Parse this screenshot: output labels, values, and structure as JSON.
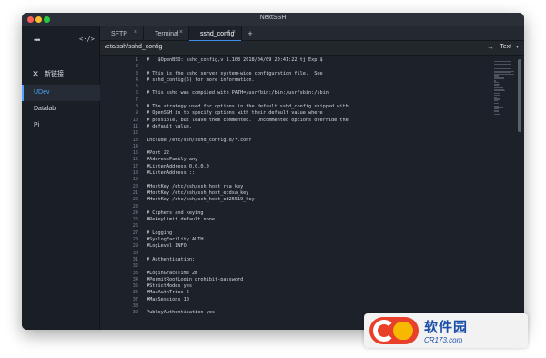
{
  "window": {
    "title": "NextSSH"
  },
  "sidebar": {
    "more_label": "•••",
    "code_label": "<·/>",
    "new_connection_label": "新链接",
    "items": [
      {
        "label": "UDev",
        "active": true
      },
      {
        "label": "Datalab",
        "active": false
      },
      {
        "label": "Pi",
        "active": false
      }
    ]
  },
  "tabs": [
    {
      "label": "SFTP",
      "active": false
    },
    {
      "label": "Terminal",
      "active": false
    },
    {
      "label": "sshd_config",
      "active": true
    }
  ],
  "tab_close_glyph": "×",
  "tab_add_glyph": "+",
  "pathbar": {
    "path": "/etc/ssh/sshd_config",
    "go_glyph": "→",
    "mode": "Text"
  },
  "editor": {
    "lines": [
      {
        "n": "1",
        "text": "#   $OpenBSD: sshd_config,v 1.103 2018/04/09 20:41:22 tj Exp $"
      },
      {
        "n": "2",
        "text": ""
      },
      {
        "n": "3",
        "text": "# This is the sshd server system-wide configuration file.  See"
      },
      {
        "n": "4",
        "text": "# sshd_config(5) for more information."
      },
      {
        "n": "5",
        "text": ""
      },
      {
        "n": "6",
        "text": "# This sshd was compiled with PATH=/usr/bin:/bin:/usr/sbin:/sbin"
      },
      {
        "n": "7",
        "text": ""
      },
      {
        "n": "8",
        "text": "# The strategy used for options in the default sshd_config shipped with"
      },
      {
        "n": "9",
        "text": "# OpenSSH is to specify options with their default value where"
      },
      {
        "n": "10",
        "text": "# possible, but leave them commented.  Uncommented options override the"
      },
      {
        "n": "11",
        "text": "# default value."
      },
      {
        "n": "12",
        "text": ""
      },
      {
        "n": "13",
        "text": "Include /etc/ssh/sshd_config.d/*.conf"
      },
      {
        "n": "14",
        "text": ""
      },
      {
        "n": "15",
        "text": "#Port 22"
      },
      {
        "n": "16",
        "text": "#AddressFamily any"
      },
      {
        "n": "17",
        "text": "#ListenAddress 0.0.0.0"
      },
      {
        "n": "18",
        "text": "#ListenAddress ::"
      },
      {
        "n": "19",
        "text": ""
      },
      {
        "n": "20",
        "text": "#HostKey /etc/ssh/ssh_host_rsa_key"
      },
      {
        "n": "21",
        "text": "#HostKey /etc/ssh/ssh_host_ecdsa_key"
      },
      {
        "n": "22",
        "text": "#HostKey /etc/ssh/ssh_host_ed25519_key"
      },
      {
        "n": "23",
        "text": ""
      },
      {
        "n": "24",
        "text": "# Ciphers and keying"
      },
      {
        "n": "25",
        "text": "#RekeyLimit default none"
      },
      {
        "n": "26",
        "text": ""
      },
      {
        "n": "27",
        "text": "# Logging"
      },
      {
        "n": "28",
        "text": "#SyslogFacility AUTH"
      },
      {
        "n": "29",
        "text": "#LogLevel INFO"
      },
      {
        "n": "30",
        "text": ""
      },
      {
        "n": "31",
        "text": "# Authentication:"
      },
      {
        "n": "32",
        "text": ""
      },
      {
        "n": "33",
        "text": "#LoginGraceTime 2m"
      },
      {
        "n": "34",
        "text": "#PermitRootLogin prohibit-password"
      },
      {
        "n": "35",
        "text": "#StrictModes yes"
      },
      {
        "n": "36",
        "text": "#MaxAuthTries 6"
      },
      {
        "n": "37",
        "text": "#MaxSessions 10"
      },
      {
        "n": "38",
        "text": ""
      },
      {
        "n": "39",
        "text": "PubkeyAuthentication yes"
      }
    ]
  },
  "watermark": {
    "name": "软件园",
    "url": "CR173.com"
  },
  "colors": {
    "accent": "#4da3ff",
    "editor_bg": "#1d222a",
    "sidebar_bg": "#1a1f26"
  }
}
